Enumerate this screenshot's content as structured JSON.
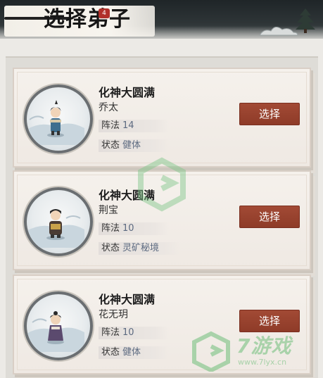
{
  "header": {
    "title": "选择弟子",
    "badge": "4"
  },
  "disciples": [
    {
      "realm": "化神大圆满",
      "name": "乔太",
      "formation_label": "阵法",
      "formation_value": "14",
      "status_label": "状态",
      "status_value": "健体",
      "button_label": "选择"
    },
    {
      "realm": "化神大圆满",
      "name": "荆宝",
      "formation_label": "阵法",
      "formation_value": "10",
      "status_label": "状态",
      "status_value": "灵矿秘境",
      "button_label": "选择"
    },
    {
      "realm": "化神大圆满",
      "name": "花无玥",
      "formation_label": "阵法",
      "formation_value": "10",
      "status_label": "状态",
      "status_value": "健体",
      "button_label": "选择"
    }
  ],
  "watermark": {
    "brand": "7游戏",
    "url": "www.7lyx.cn"
  },
  "colors": {
    "button": "#9a4532",
    "stat_value": "#5c6a80",
    "watermark": "#6ebe78"
  }
}
